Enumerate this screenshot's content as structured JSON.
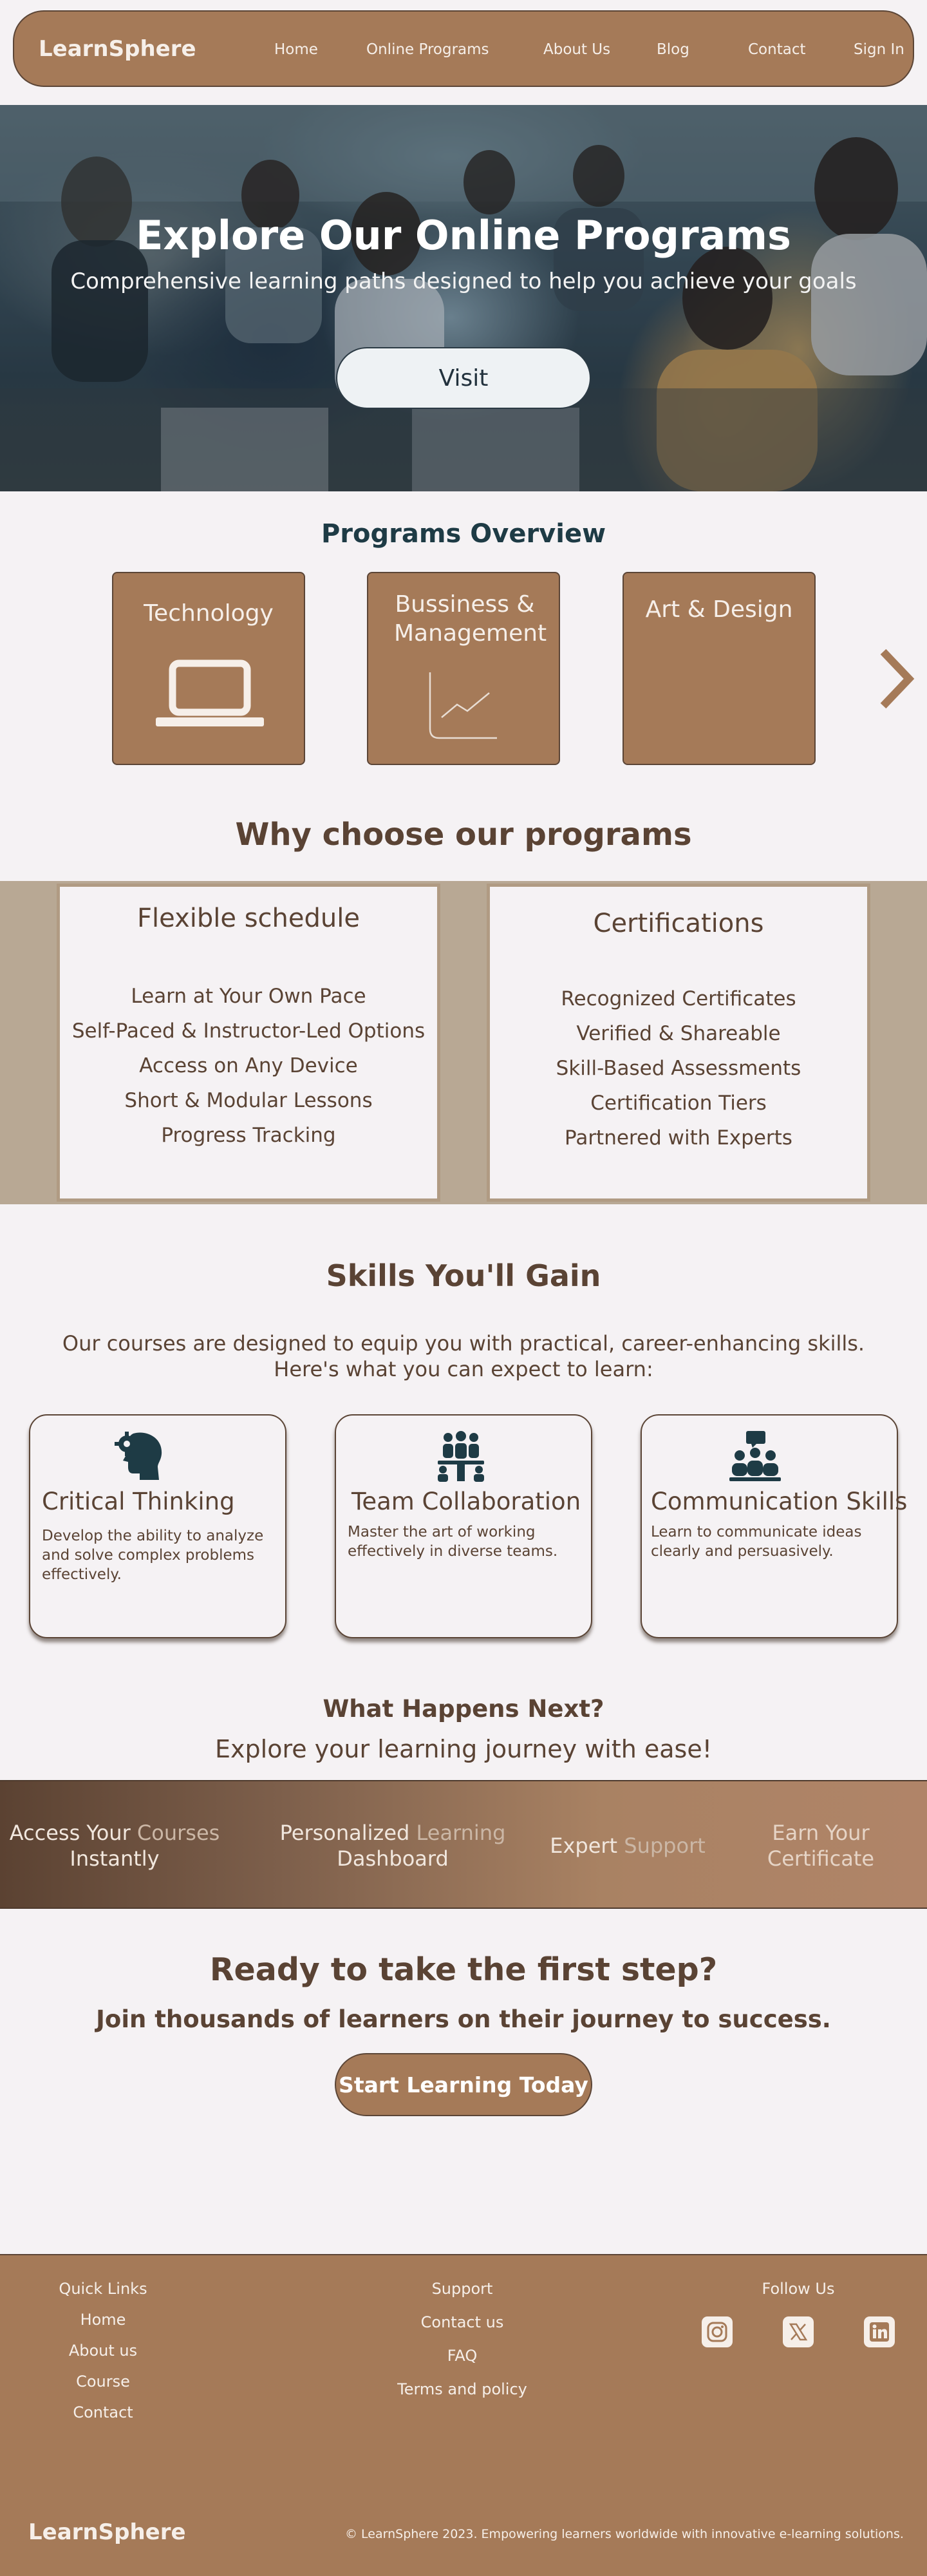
{
  "nav": {
    "brand": "LearnSphere",
    "links": [
      "Home",
      "Online Programs",
      "About Us",
      "Blog",
      "Contact",
      "Sign In"
    ]
  },
  "hero": {
    "title": "Explore Our Online Programs",
    "subtitle": "Comprehensive learning paths designed to help you achieve your goals",
    "button": "Visit"
  },
  "programs": {
    "title": "Programs Overview",
    "cards": [
      {
        "label": "Technology",
        "icon": "laptop-icon"
      },
      {
        "label": "Bussiness & Management",
        "icon": "chart-icon"
      },
      {
        "label": "Art & Design",
        "icon": ""
      }
    ],
    "next_icon": "chevron-right-icon"
  },
  "why": {
    "title": "Why choose our programs",
    "boxes": [
      {
        "heading": "Flexible schedule",
        "items": [
          "Learn at Your Own Pace",
          "Self-Paced & Instructor-Led Options",
          "Access on Any Device",
          "Short & Modular Lessons",
          "Progress Tracking"
        ]
      },
      {
        "heading": "Certifications",
        "items": [
          "Recognized Certificates",
          "Verified & Shareable",
          "Skill-Based Assessments",
          "Certification Tiers",
          "Partnered with Experts"
        ]
      }
    ]
  },
  "skills": {
    "title": "Skills You'll Gain",
    "intro_line1": "Our courses are designed to equip you with practical, career-enhancing skills.",
    "intro_line2": "Here's what you can expect to learn:",
    "cards": [
      {
        "title": "Critical Thinking",
        "desc": "Develop the ability to analyze and solve complex problems effectively.",
        "icon": "brain-gear-icon"
      },
      {
        "title": "Team Collaboration",
        "desc": "Master the art of working effectively in diverse teams.",
        "icon": "team-meeting-icon"
      },
      {
        "title": "Communication Skills",
        "desc": "Learn to communicate ideas clearly and persuasively.",
        "icon": "presentation-icon"
      }
    ]
  },
  "next": {
    "title": "What Happens Next?",
    "subtitle": "Explore your learning journey with ease!",
    "steps": [
      {
        "line1_a": "Access Your",
        "line1_b": "Courses",
        "line2": "Instantly"
      },
      {
        "line1_a": "Personalized",
        "line1_b": "Learning",
        "line2": "Dashboard"
      },
      {
        "line1_a": "Expert",
        "line1_b": "Support",
        "line2": ""
      },
      {
        "line1_a": "Earn Your",
        "line1_b": "",
        "line2": "Certificate"
      }
    ]
  },
  "cta": {
    "title": "Ready to take the first step?",
    "subtitle": "Join thousands of learners on their journey to success.",
    "button": "Start Learning Today"
  },
  "footer": {
    "quick_links_title": "Quick Links",
    "quick_links": [
      "Home",
      "About us",
      "Course",
      "Contact"
    ],
    "support_title": "Support",
    "support_links": [
      "Contact us",
      "FAQ",
      "Terms and policy"
    ],
    "follow_title": "Follow Us",
    "socials": [
      "instagram-icon",
      "x-icon",
      "linkedin-icon"
    ],
    "brand": "LearnSphere",
    "copyright": "© LearnSphere 2023. Empowering learners worldwide with innovative e-learning solutions."
  },
  "colors": {
    "brand_brown": "#a57a58",
    "dark_brown": "#5a4334",
    "teal_dark": "#1e3b45",
    "background": "#f5f2f4",
    "band": "#b8a894"
  }
}
